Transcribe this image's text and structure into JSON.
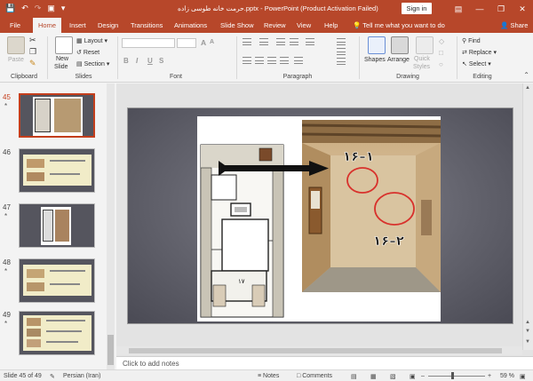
{
  "title_bar": {
    "document_title": "حرمت خانه طوسی زاده.pptx  -  PowerPoint (Product Activation Failed)",
    "sign_in_label": "Sign in",
    "quick_access": [
      "save-icon",
      "undo-icon",
      "redo-icon",
      "start-presentation-icon",
      "customize-icon"
    ],
    "window_controls": [
      "ribbon-display-icon",
      "minimize-icon",
      "maximize-icon",
      "close-icon"
    ]
  },
  "tabs": [
    "File",
    "Home",
    "Insert",
    "Design",
    "Transitions",
    "Animations",
    "Slide Show",
    "Review",
    "View",
    "Help"
  ],
  "active_tab": "Home",
  "tell_me": "Tell me what you want to do",
  "share_label": "Share",
  "ribbon": {
    "clipboard": {
      "paste": "Paste",
      "label": "Clipboard"
    },
    "slides": {
      "new_slide_line1": "New",
      "new_slide_line2": "Slide",
      "layout": "Layout",
      "reset": "Reset",
      "section": "Section",
      "label": "Slides"
    },
    "font": {
      "grow": "A",
      "shrink": "A",
      "bold": "B",
      "italic": "I",
      "underline": "U",
      "strike": "S",
      "label": "Font"
    },
    "paragraph": {
      "label": "Paragraph"
    },
    "drawing": {
      "shapes": "Shapes",
      "arrange": "Arrange",
      "quick_styles_line1": "Quick",
      "quick_styles_line2": "Styles",
      "label": "Drawing"
    },
    "editing": {
      "find": "Find",
      "replace": "Replace",
      "select": "Select",
      "label": "Editing"
    }
  },
  "thumbnails": [
    {
      "number": "45",
      "starred": true,
      "selected": true
    },
    {
      "number": "46",
      "starred": false,
      "selected": false
    },
    {
      "number": "47",
      "starred": true,
      "selected": false
    },
    {
      "number": "48",
      "starred": true,
      "selected": false
    },
    {
      "number": "49",
      "starred": true,
      "selected": false
    }
  ],
  "slide": {
    "label_1": "۱۶–۱",
    "label_2": "۱۶–۲",
    "room_number": "۱۷"
  },
  "notes_placeholder": "Click to add notes",
  "status_bar": {
    "slide_info": "Slide 45 of 49",
    "language": "Persian (Iran)",
    "notes": "Notes",
    "comments": "Comments",
    "zoom": "59 %"
  },
  "colors": {
    "accent": "#b7472a",
    "selection": "#c43e1c",
    "slide_bg": "#63636d"
  }
}
